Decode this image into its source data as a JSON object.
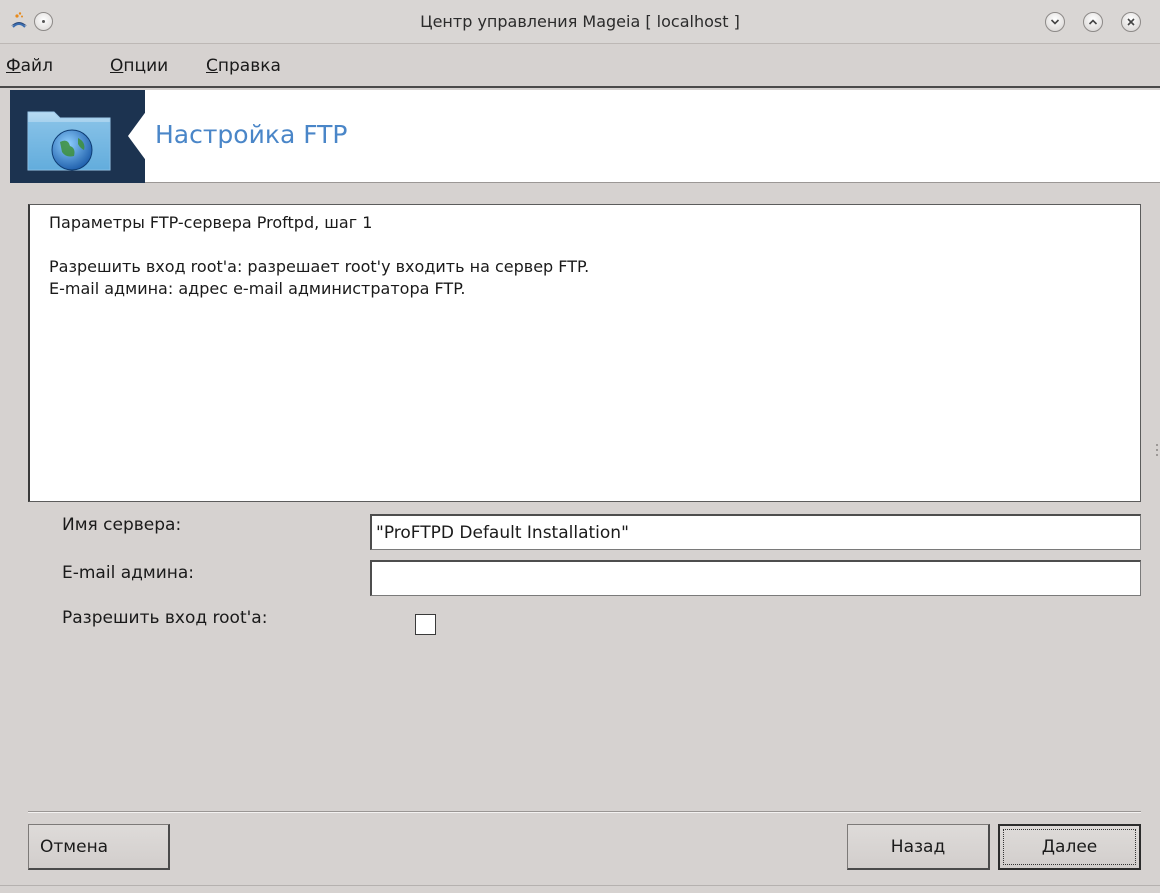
{
  "window": {
    "title": "Центр управления Mageia  [ localhost ]"
  },
  "menubar": {
    "items": [
      {
        "mnemonic": "Ф",
        "rest": "айл"
      },
      {
        "mnemonic": "О",
        "rest": "пции"
      },
      {
        "mnemonic": "С",
        "rest": "правка"
      }
    ]
  },
  "banner": {
    "title": "Настройка FTP",
    "icon": "ftp-folder-globe-icon"
  },
  "description": {
    "lines": [
      "Параметры FTP-сервера Proftpd, шаг 1",
      "",
      "Разрешить вход root'а: разрешает root'у входить на сервер FTP.",
      "E-mail админа: адрес e-mail администратора FTP."
    ]
  },
  "form": {
    "server_name_label": "Имя сервера:",
    "server_name_value": "\"ProFTPD Default Installation\"",
    "admin_email_label": "E-mail админа:",
    "admin_email_value": "",
    "allow_root_label": "Разрешить вход root'а:",
    "allow_root_checked": false
  },
  "buttons": {
    "cancel": "Отмена",
    "back": "Назад",
    "next": "Далее"
  }
}
